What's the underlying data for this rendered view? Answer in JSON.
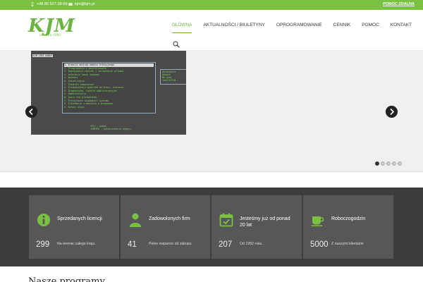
{
  "topbar": {
    "phone": "+48 89 527-38-69",
    "email": "kjm@kjm.pl",
    "help_label": "POMOC ZDALNA"
  },
  "logo": {
    "mark": "KJM",
    "tagline": "od roku 1992"
  },
  "nav": {
    "items": [
      {
        "label": "GŁÓWNA",
        "active": true
      },
      {
        "label": "AKTUALNOŚCI / BIULETYNY",
        "active": false
      },
      {
        "label": "OPROGRAMOWANIE",
        "active": false
      },
      {
        "label": "CENNIK",
        "active": false
      },
      {
        "label": "POMOC",
        "active": false
      },
      {
        "label": "KONTAKT",
        "active": false
      }
    ]
  },
  "slider": {
    "terminal_header": "KJM 1992 KADRY",
    "terminal_menu": [
      "1. Kreacja obsługi modułu kreacyjnego",
      "2. Przeglądanie i kontrolowanie",
      "3. Dopisywanie zbiorów i zarządzanie plikami",
      "4. Ustalanie nowej blokady",
      "5. Wydruki",
      "6. Aktualizacja",
      "7. Słowniki pomocnicze",
      "8. Przypominanie wydarzeń od pracy, kierowcy",
      "9. Diagnostyka, funkcje administracyjne",
      "A. Administracja",
      "B. Opcje dla pracowników",
      "C. Przesyłanie wiadomości wydruku",
      "D. Informacje o modułach w programie",
      "E. Koniec pracy"
    ],
    "terminal_side": [
      "Ustawienia",
      "danych",
      "Ma  wpis",
      "<shift>F10"
    ],
    "terminal_footer": [
      "<F1>   - pomoc",
      "<ENTER> - potwierdzenie wyboru"
    ],
    "dots": [
      true,
      false,
      false,
      false,
      false
    ]
  },
  "stats": [
    {
      "icon": "info-icon",
      "title": "Sprzedanych licencji",
      "number": "299",
      "desc": "Na terenie całego kraju."
    },
    {
      "icon": "user-icon",
      "title": "Zadowolonych firm",
      "number": "41",
      "desc": "Pełne wsparcie od zakupu"
    },
    {
      "icon": "calendar-icon",
      "title": "Jesteśmy już od ponad 20 lat",
      "number": "207",
      "desc": "Od 1992 roku."
    },
    {
      "icon": "coffee-icon",
      "title": "Roboczogodzin",
      "number": "5000",
      "desc": "Z naszymi klientami"
    }
  ],
  "bottom": {
    "heading": "Nasze programy"
  },
  "colors": {
    "accent": "#7ac143",
    "stats_bg": "#3d3d3d",
    "stat_box": "#575757"
  }
}
